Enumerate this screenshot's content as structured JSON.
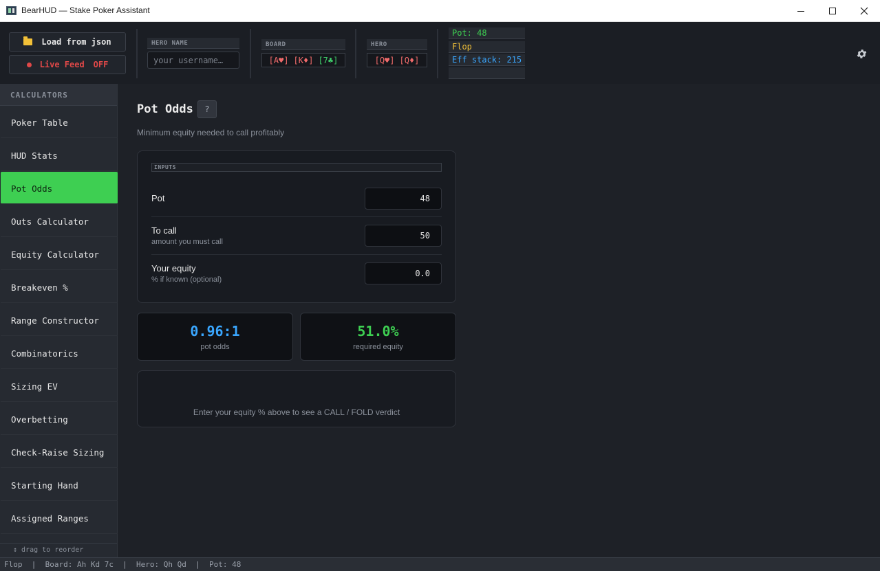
{
  "window": {
    "title": "BearHUD — Stake Poker Assistant"
  },
  "topbar": {
    "load_label": "Load from json",
    "live_label": "Live Feed",
    "live_state": "OFF",
    "hero_name_label": "HERO NAME",
    "hero_name_placeholder": "your username…",
    "board_label": "BOARD",
    "board_cards": [
      "[A♥]",
      "[K♦]",
      "[7♣]"
    ],
    "hero_label": "HERO",
    "hero_cards": [
      "[Q♥]",
      "[Q♦]"
    ],
    "info": {
      "pot": "Pot: 48",
      "street": "Flop",
      "eff_stack": "Eff stack: 215"
    },
    "colors": {
      "pot": "#3ecf52",
      "street": "#f2c038",
      "eff_stack": "#3aa7ff"
    }
  },
  "sidebar": {
    "header": "CALCULATORS",
    "items": [
      {
        "label": "Poker Table",
        "active": false
      },
      {
        "label": "HUD Stats",
        "active": false
      },
      {
        "label": "Pot Odds",
        "active": true
      },
      {
        "label": "Outs Calculator",
        "active": false
      },
      {
        "label": "Equity Calculator",
        "active": false
      },
      {
        "label": "Breakeven %",
        "active": false
      },
      {
        "label": "Range Constructor",
        "active": false
      },
      {
        "label": "Combinatorics",
        "active": false
      },
      {
        "label": "Sizing EV",
        "active": false
      },
      {
        "label": "Overbetting",
        "active": false
      },
      {
        "label": "Check-Raise Sizing",
        "active": false
      },
      {
        "label": "Starting Hand",
        "active": false
      },
      {
        "label": "Assigned Ranges",
        "active": false
      }
    ],
    "drag_hint": "↕ drag to reorder"
  },
  "main": {
    "title": "Pot Odds",
    "help": "?",
    "subtitle": "Minimum equity needed to call profitably",
    "inputs_label": "INPUTS",
    "inputs": {
      "pot": {
        "label": "Pot",
        "value": "48"
      },
      "to_call": {
        "label": "To call",
        "hint": "amount you must call",
        "value": "50"
      },
      "equity": {
        "label": "Your equity",
        "hint": "% if known (optional)",
        "value": "0.0"
      }
    },
    "results": {
      "pot_odds": {
        "value": "0.96:1",
        "caption": "pot odds"
      },
      "required_equity": {
        "value": "51.0%",
        "caption": "required equity"
      }
    },
    "verdict": "Enter your equity % above to see a CALL / FOLD verdict"
  },
  "statusbar": "Flop  |  Board: Ah Kd 7c  |  Hero: Qh Qd  |  Pot: 48"
}
